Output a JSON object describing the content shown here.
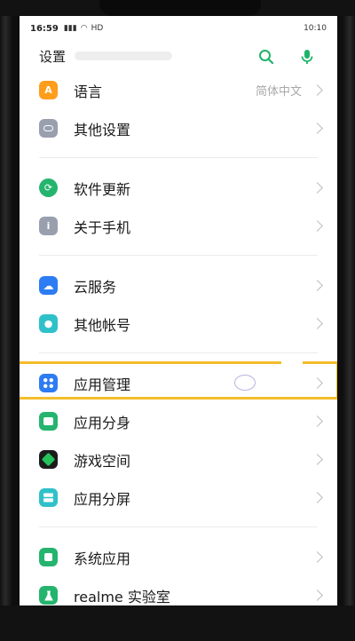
{
  "status_bar": {
    "time": "16:59",
    "network": "HD",
    "right": "10:10"
  },
  "header": {
    "title": "设置"
  },
  "colors": {
    "accent": "#20b26a",
    "highlight": "#f4be2a"
  },
  "items": [
    {
      "label": "语言",
      "value": "简体中文",
      "icon": "language-icon",
      "color": "#ff9d1c"
    },
    {
      "label": "其他设置",
      "value": "",
      "icon": "more-settings-icon",
      "color": "#9a9fae"
    },
    {
      "label": "软件更新",
      "value": "",
      "icon": "update-icon",
      "color": "#24b46e"
    },
    {
      "label": "关于手机",
      "value": "",
      "icon": "info-icon",
      "color": "#9a9fae"
    },
    {
      "label": "云服务",
      "value": "",
      "icon": "cloud-icon",
      "color": "#2d7cf3"
    },
    {
      "label": "其他帐号",
      "value": "",
      "icon": "account-icon",
      "color": "#2fc1c9"
    },
    {
      "label": "应用管理",
      "value": "",
      "icon": "apps-icon",
      "color": "#2d7cf3"
    },
    {
      "label": "应用分身",
      "value": "",
      "icon": "clone-icon",
      "color": "#24b46e"
    },
    {
      "label": "游戏空间",
      "value": "",
      "icon": "game-space-icon",
      "color": "#1c1c1c"
    },
    {
      "label": "应用分屏",
      "value": "",
      "icon": "split-screen-icon",
      "color": "#2fc1c9"
    },
    {
      "label": "系统应用",
      "value": "",
      "icon": "system-apps-icon",
      "color": "#24b46e"
    },
    {
      "label": "realme 实验室",
      "value": "",
      "icon": "lab-icon",
      "color": "#24b46e"
    }
  ]
}
